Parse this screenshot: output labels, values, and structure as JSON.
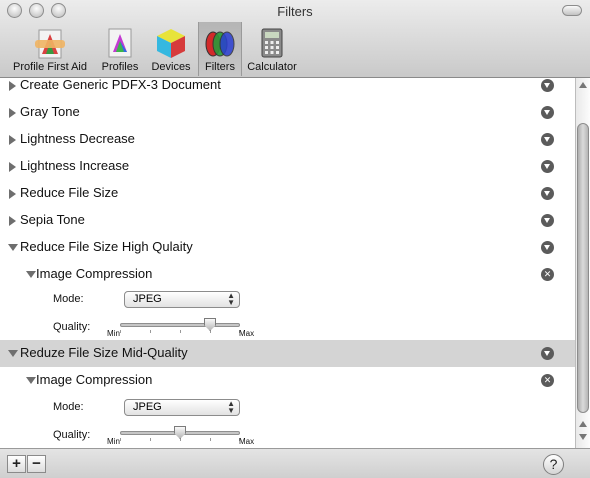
{
  "window": {
    "title": "Filters"
  },
  "toolbar": {
    "profile_first_aid": "Profile First Aid",
    "profiles": "Profiles",
    "devices": "Devices",
    "filters": "Filters",
    "calculator": "Calculator"
  },
  "list": {
    "items": [
      "Create Generic PDFX-3 Document",
      "Gray Tone",
      "Lightness Decrease",
      "Lightness Increase",
      "Reduce File Size",
      "Sepia Tone",
      "Reduce File Size High Qulaity",
      "Reduze File Size Mid-Quality"
    ],
    "sub_item": "Image Compression",
    "mode_label": "Mode:",
    "quality_label": "Quality:",
    "mode_value": "JPEG",
    "slider_min": "Min",
    "slider_max": "Max",
    "quality_high": 0.75,
    "quality_mid": 0.5
  },
  "bottom": {
    "add": "+",
    "remove": "−",
    "help": "?"
  }
}
